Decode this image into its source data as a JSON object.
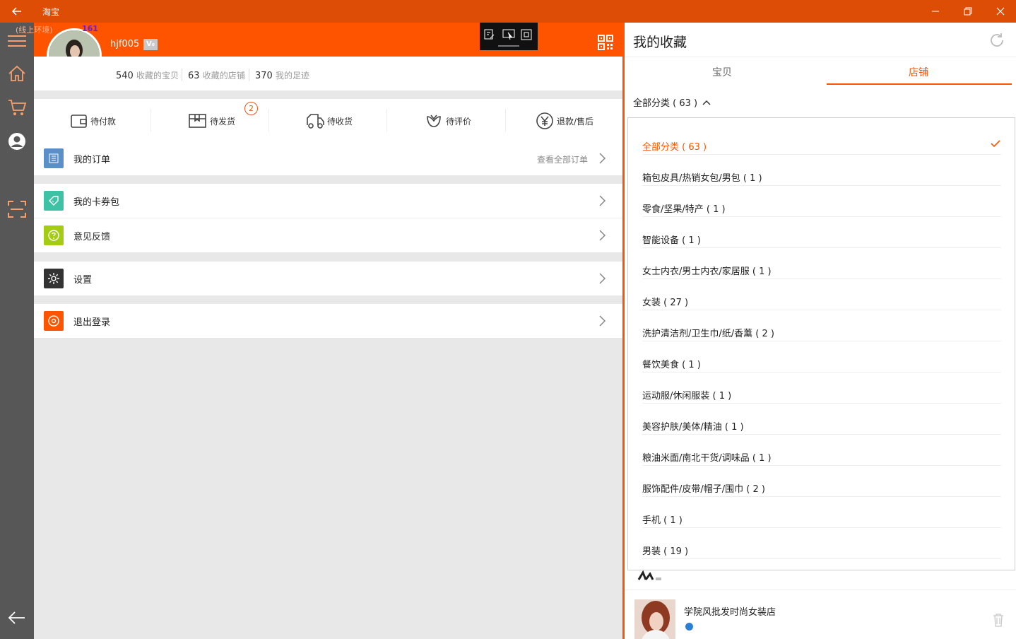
{
  "window": {
    "title": "淘宝"
  },
  "env_label": "(线上环境)",
  "counter": "161",
  "profile": {
    "username": "hjf005",
    "vip_badge": "V₀",
    "stats": [
      {
        "value": "540",
        "label": "收藏的宝贝"
      },
      {
        "value": "63",
        "label": "收藏的店铺"
      },
      {
        "value": "370",
        "label": "我的足迹"
      }
    ]
  },
  "orders": {
    "items": [
      {
        "label": "待付款",
        "icon": "wallet-icon"
      },
      {
        "label": "待发货",
        "icon": "package-icon",
        "badge": "2"
      },
      {
        "label": "待收货",
        "icon": "truck-icon"
      },
      {
        "label": "待评价",
        "icon": "flower-icon"
      },
      {
        "label": "退款/售后",
        "icon": "yen-refund-icon"
      }
    ]
  },
  "menu": {
    "my_orders": "我的订单",
    "view_all_orders": "查看全部订单",
    "coupons": "我的卡券包",
    "feedback": "意见反馈",
    "settings": "设置",
    "logout": "退出登录"
  },
  "favorites": {
    "title": "我的收藏",
    "tabs": [
      "宝贝",
      "店铺"
    ],
    "active_tab": "店铺",
    "filter_label": "全部分类 ( 63 )",
    "categories": [
      "全部分类 ( 63 )",
      "箱包皮具/热销女包/男包 ( 1 )",
      "零食/坚果/特产 ( 1 )",
      "智能设备 ( 1 )",
      "女士内衣/男士内衣/家居服 ( 1 )",
      "女装 ( 27 )",
      "洗护清洁剂/卫生巾/纸/香薰 ( 2 )",
      "餐饮美食 ( 1 )",
      "运动服/休闲服装 ( 1 )",
      "美容护肤/美体/精油 ( 1 )",
      "粮油米面/南北干货/调味品 ( 1 )",
      "服饰配件/皮带/帽子/围巾 ( 2 )",
      "手机 ( 1 )",
      "男装 ( 19 )"
    ],
    "selected_category": "全部分类 ( 63 )",
    "shop_name": "学院风批发时尚女装店"
  },
  "colors": {
    "accent": "#fe5400",
    "titlebar": "#de4d06",
    "rail": "#575757"
  }
}
